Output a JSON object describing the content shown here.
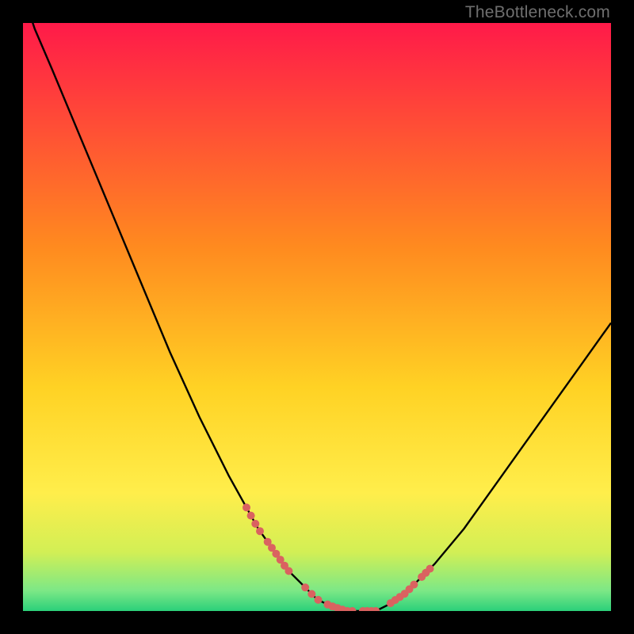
{
  "watermark": "TheBottleneck.com",
  "colors": {
    "red": "#ff1a49",
    "orange": "#ffa300",
    "yellow": "#ffe638",
    "near_green": "#b4f04a",
    "green": "#2ecf77",
    "curve_stroke": "#000000",
    "dots": "#da6260",
    "frame": "#000000"
  },
  "chart_data": {
    "type": "line",
    "title": "",
    "xlabel": "",
    "ylabel": "",
    "xlim": [
      0,
      100
    ],
    "ylim": [
      0,
      100
    ],
    "series": [
      {
        "name": "bottleneck-curve",
        "x": [
          0,
          2,
          5,
          10,
          15,
          20,
          25,
          30,
          35,
          40,
          45,
          48,
          50,
          52,
          55,
          57,
          60,
          62,
          65,
          70,
          75,
          80,
          85,
          90,
          95,
          100
        ],
        "y": [
          105,
          99,
          92,
          80,
          68,
          56,
          44,
          33,
          23,
          14,
          7,
          4,
          2,
          1,
          0,
          0,
          0,
          1,
          3,
          8,
          14,
          21,
          28,
          35,
          42,
          49
        ]
      }
    ],
    "points": {
      "name": "highlighted-segments",
      "left_cluster": {
        "x_range": [
          38,
          45
        ],
        "y_range": [
          7,
          17
        ]
      },
      "valley_cluster": {
        "x_range": [
          49,
          60
        ],
        "y_range": [
          0,
          2
        ]
      },
      "right_cluster": {
        "x_range": [
          63,
          69
        ],
        "y_range": [
          3,
          9
        ]
      }
    },
    "gradient_stops": [
      {
        "offset": 0.0,
        "color": "#ff1a49"
      },
      {
        "offset": 0.38,
        "color": "#ff8a1f"
      },
      {
        "offset": 0.62,
        "color": "#ffd224"
      },
      {
        "offset": 0.8,
        "color": "#ffee4b"
      },
      {
        "offset": 0.9,
        "color": "#d2ef55"
      },
      {
        "offset": 0.965,
        "color": "#7de886"
      },
      {
        "offset": 1.0,
        "color": "#2bd07a"
      }
    ]
  }
}
